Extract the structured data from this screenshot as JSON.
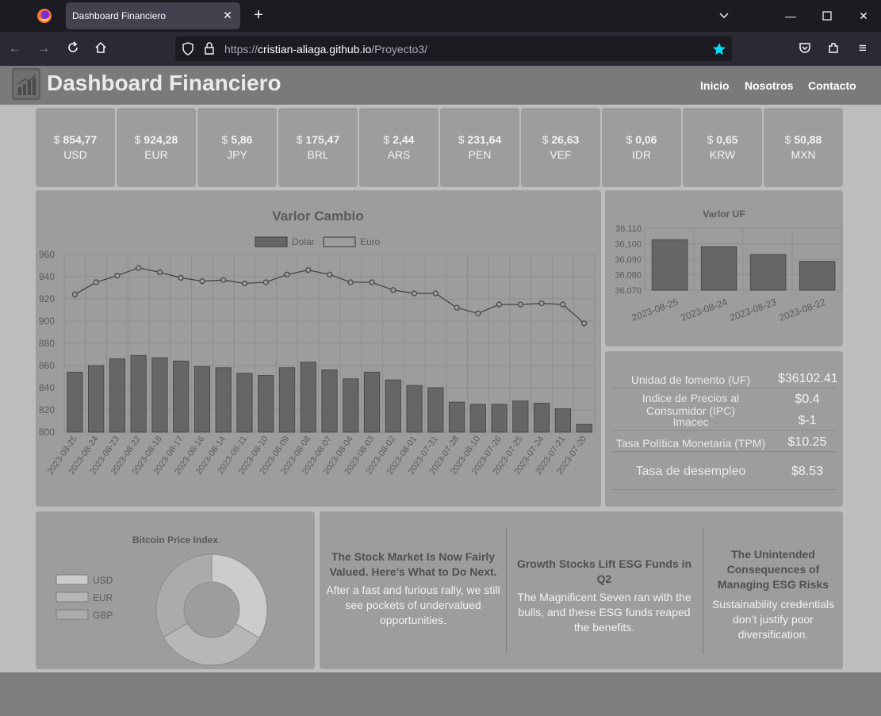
{
  "browser": {
    "tab_title": "Dashboard Financiero",
    "url_prefix": "https://",
    "url_host": "cristian-aliaga.github.io",
    "url_path": "/Proyecto3/"
  },
  "header": {
    "title": "Dashboard Financiero",
    "menu": [
      "Inicio",
      "Nosotros",
      "Contacto"
    ]
  },
  "currencies": [
    {
      "value": "854,77",
      "code": "USD"
    },
    {
      "value": "924,28",
      "code": "EUR"
    },
    {
      "value": "5,86",
      "code": "JPY"
    },
    {
      "value": "175,47",
      "code": "BRL"
    },
    {
      "value": "2,44",
      "code": "ARS"
    },
    {
      "value": "231,64",
      "code": "PEN"
    },
    {
      "value": "26,63",
      "code": "VEF"
    },
    {
      "value": "0,06",
      "code": "IDR"
    },
    {
      "value": "0,65",
      "code": "KRW"
    },
    {
      "value": "50,88",
      "code": "MXN"
    }
  ],
  "currency_symbol": "$",
  "indicators": [
    {
      "name": "Unidad de fomento (UF)",
      "value": "$36102.41"
    },
    {
      "name": "Indice de Precios al Consumidor (IPC)",
      "value": "$0.4"
    },
    {
      "name": "Imacec",
      "value": "$-1"
    },
    {
      "name": "Tasa Política Monetaria (TPM)",
      "value": "$10.25"
    },
    {
      "name": "Tasa de desempleo",
      "value": "$8.53"
    }
  ],
  "news": [
    {
      "title": "The Stock Market Is Now Fairly Valued. Here’s What to Do Next.",
      "body": "After a fast and furious rally, we still see pockets of undervalued opportunities."
    },
    {
      "title": "Growth Stocks Lift ESG Funds in Q2",
      "body": "The Magnificent Seven ran with the bulls, and these ESG funds reaped the benefits."
    },
    {
      "title": "The Unintended Consequences of Managing ESG Risks",
      "body": "Sustainability credentials don’t justify poor diversification."
    }
  ],
  "chart_data": [
    {
      "type": "bar",
      "title": "Varlor Cambio",
      "categories": [
        "2023-08-25",
        "2023-08-24",
        "2023-08-23",
        "2023-08-22",
        "2023-08-18",
        "2023-08-17",
        "2023-08-16",
        "2023-08-14",
        "2023-08-11",
        "2023-08-10",
        "2023-08-09",
        "2023-08-08",
        "2023-08-07",
        "2023-08-04",
        "2023-08-03",
        "2023-08-02",
        "2023-08-01",
        "2023-07-31",
        "2023-07-28",
        "2023-08-10",
        "2023-07-26",
        "2023-07-25",
        "2023-07-24",
        "2023-07-21",
        "2023-07-20"
      ],
      "series": [
        {
          "name": "Dolar",
          "kind": "bar",
          "color": "#666666",
          "values": [
            854,
            860,
            866,
            869,
            867,
            864,
            859,
            858,
            853,
            851,
            858,
            863,
            856,
            848,
            854,
            847,
            842,
            840,
            827,
            825,
            825,
            828,
            826,
            821,
            807
          ]
        },
        {
          "name": "Euro",
          "kind": "line",
          "color": "#444444",
          "values": [
            924,
            935,
            941,
            948,
            944,
            939,
            936,
            937,
            934,
            935,
            942,
            946,
            942,
            935,
            935,
            928,
            925,
            925,
            912,
            907,
            915,
            915,
            916,
            915,
            898
          ]
        }
      ],
      "ylim": [
        800,
        960
      ],
      "yticks": [
        800,
        820,
        840,
        860,
        880,
        900,
        920,
        940,
        960
      ],
      "legend": "top",
      "grid": true
    },
    {
      "type": "bar",
      "title": "Varlor UF",
      "categories": [
        "2023-08-25",
        "2023-08-24",
        "2023-08-23",
        "2023-08-22"
      ],
      "values": [
        36102.6,
        36098.1,
        36093.1,
        36088.6
      ],
      "ylim": [
        36070,
        36110
      ],
      "yticks": [
        "36,070",
        "36,080",
        "36,090",
        "36,100",
        "36,110"
      ],
      "grid": true
    },
    {
      "type": "pie",
      "title": "Bitcoin Price Index",
      "labels": [
        "USD",
        "EUR",
        "GBP"
      ],
      "values": [
        33.5,
        33.3,
        33.2
      ],
      "colors": [
        "#cccccc",
        "#b7b7b7",
        "#ababab"
      ],
      "legend": "left"
    }
  ]
}
